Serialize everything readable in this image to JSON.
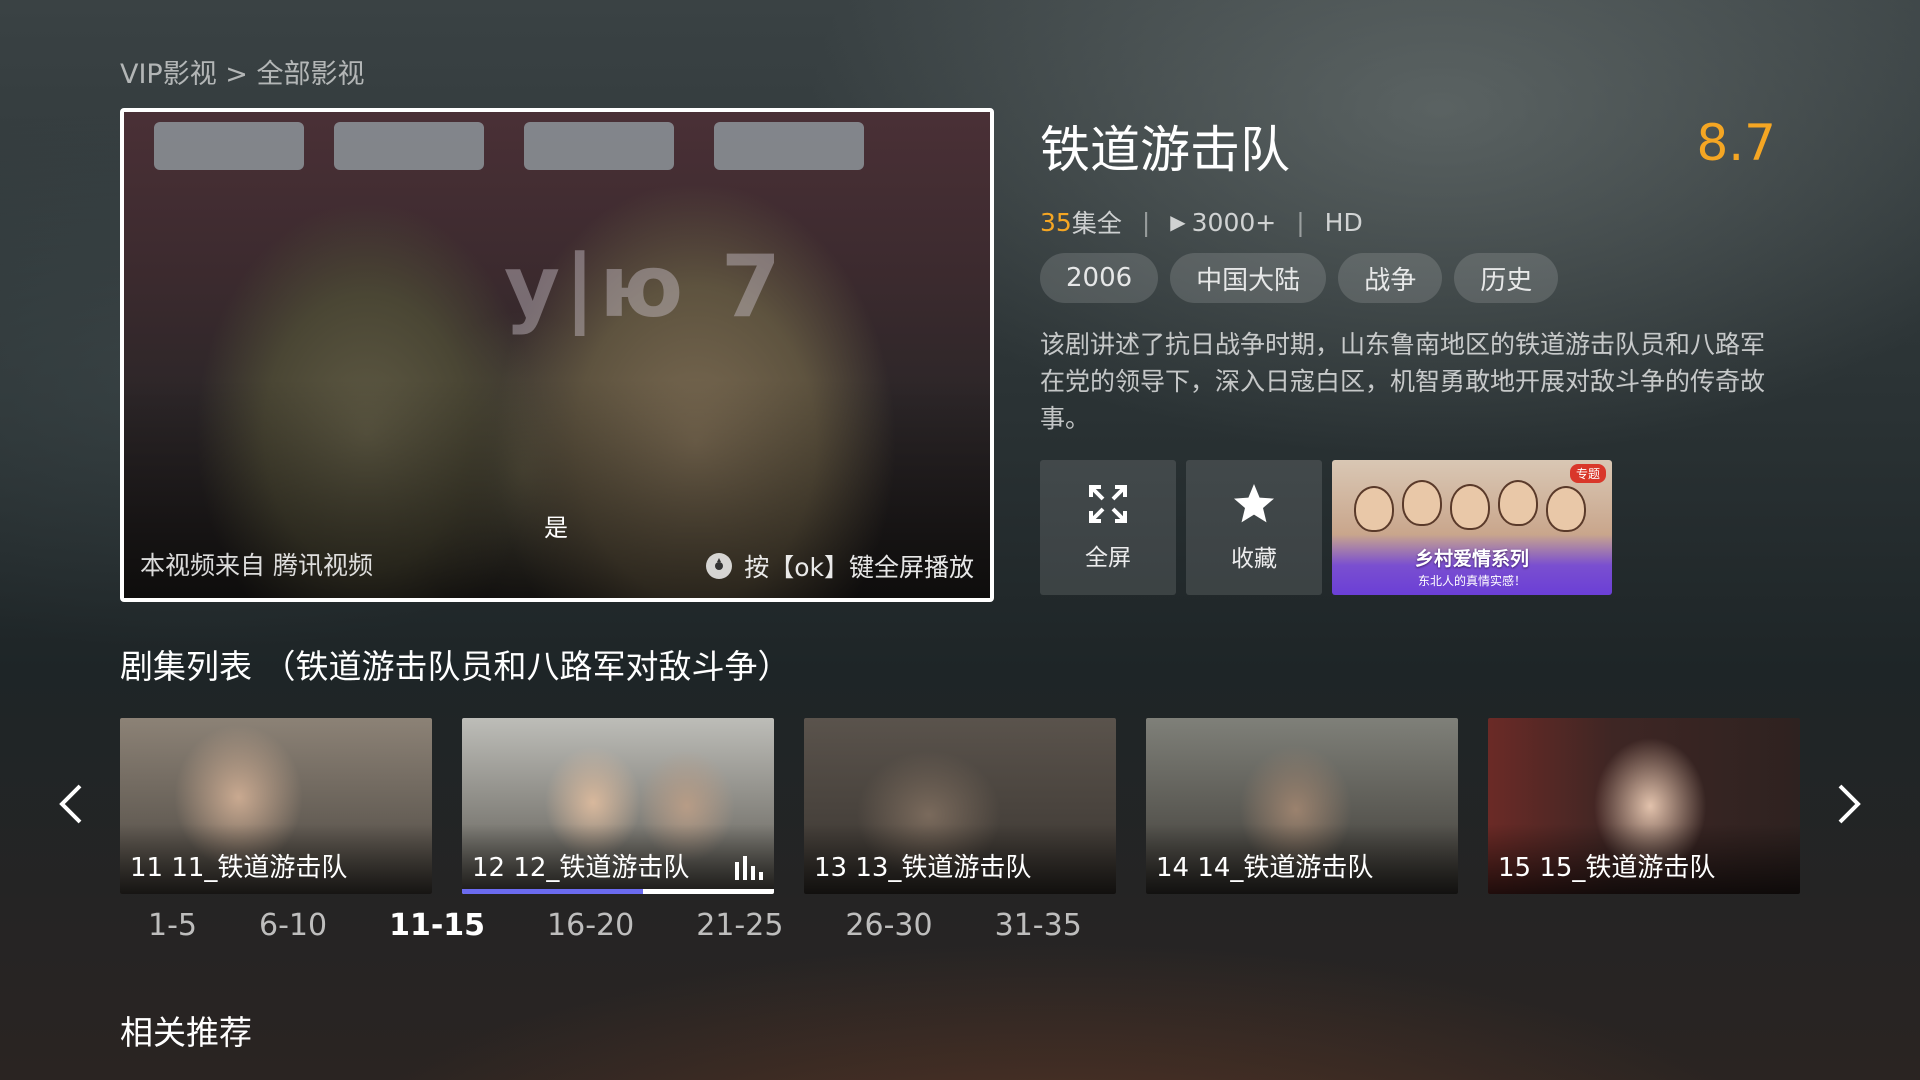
{
  "breadcrumb": "VIP影视 > 全部影视",
  "player": {
    "source_text": "本视频来自 腾讯视频",
    "hint_text": "按【ok】键全屏播放",
    "subtitle": "是",
    "sign_text": "у|ю 7"
  },
  "show": {
    "title": "铁道游击队",
    "score": "8.7",
    "episode_count": "35",
    "episode_suffix": "集全",
    "views": "3000+",
    "quality": "HD",
    "tags": [
      "2006",
      "中国大陆",
      "战争",
      "历史"
    ],
    "description": "该剧讲述了抗日战争时期，山东鲁南地区的铁道游击队员和八路军在党的领导下，深入日寇白区，机智勇敢地开展对敌斗争的传奇故事。"
  },
  "actions": {
    "fullscreen_label": "全屏",
    "favorite_label": "收藏",
    "promo_badge": "专题",
    "promo_title": "乡村爱情系列",
    "promo_subtitle": "东北人的真情实感！"
  },
  "episode_section": {
    "title": "剧集列表 （铁道游击队员和八路军对敌斗争）",
    "episodes": [
      {
        "label": "11 11_铁道游击队"
      },
      {
        "label": "12 12_铁道游击队",
        "progress": 0.58
      },
      {
        "label": "13 13_铁道游击队"
      },
      {
        "label": "14 14_铁道游击队"
      },
      {
        "label": "15 15_铁道游击队"
      }
    ],
    "ranges": [
      "1-5",
      "6-10",
      "11-15",
      "16-20",
      "21-25",
      "26-30",
      "31-35"
    ],
    "active_range": "11-15"
  },
  "related_title": "相关推荐",
  "colors": {
    "accent": "#f5a623",
    "progress": "#6b6bf0"
  },
  "icons": {
    "fullscreen": "fullscreen-icon",
    "favorite": "star-icon",
    "playing": "equalizer-icon",
    "prev": "chevron-left-icon",
    "next": "chevron-right-icon",
    "hint": "ok-key-icon",
    "views": "play-icon"
  }
}
